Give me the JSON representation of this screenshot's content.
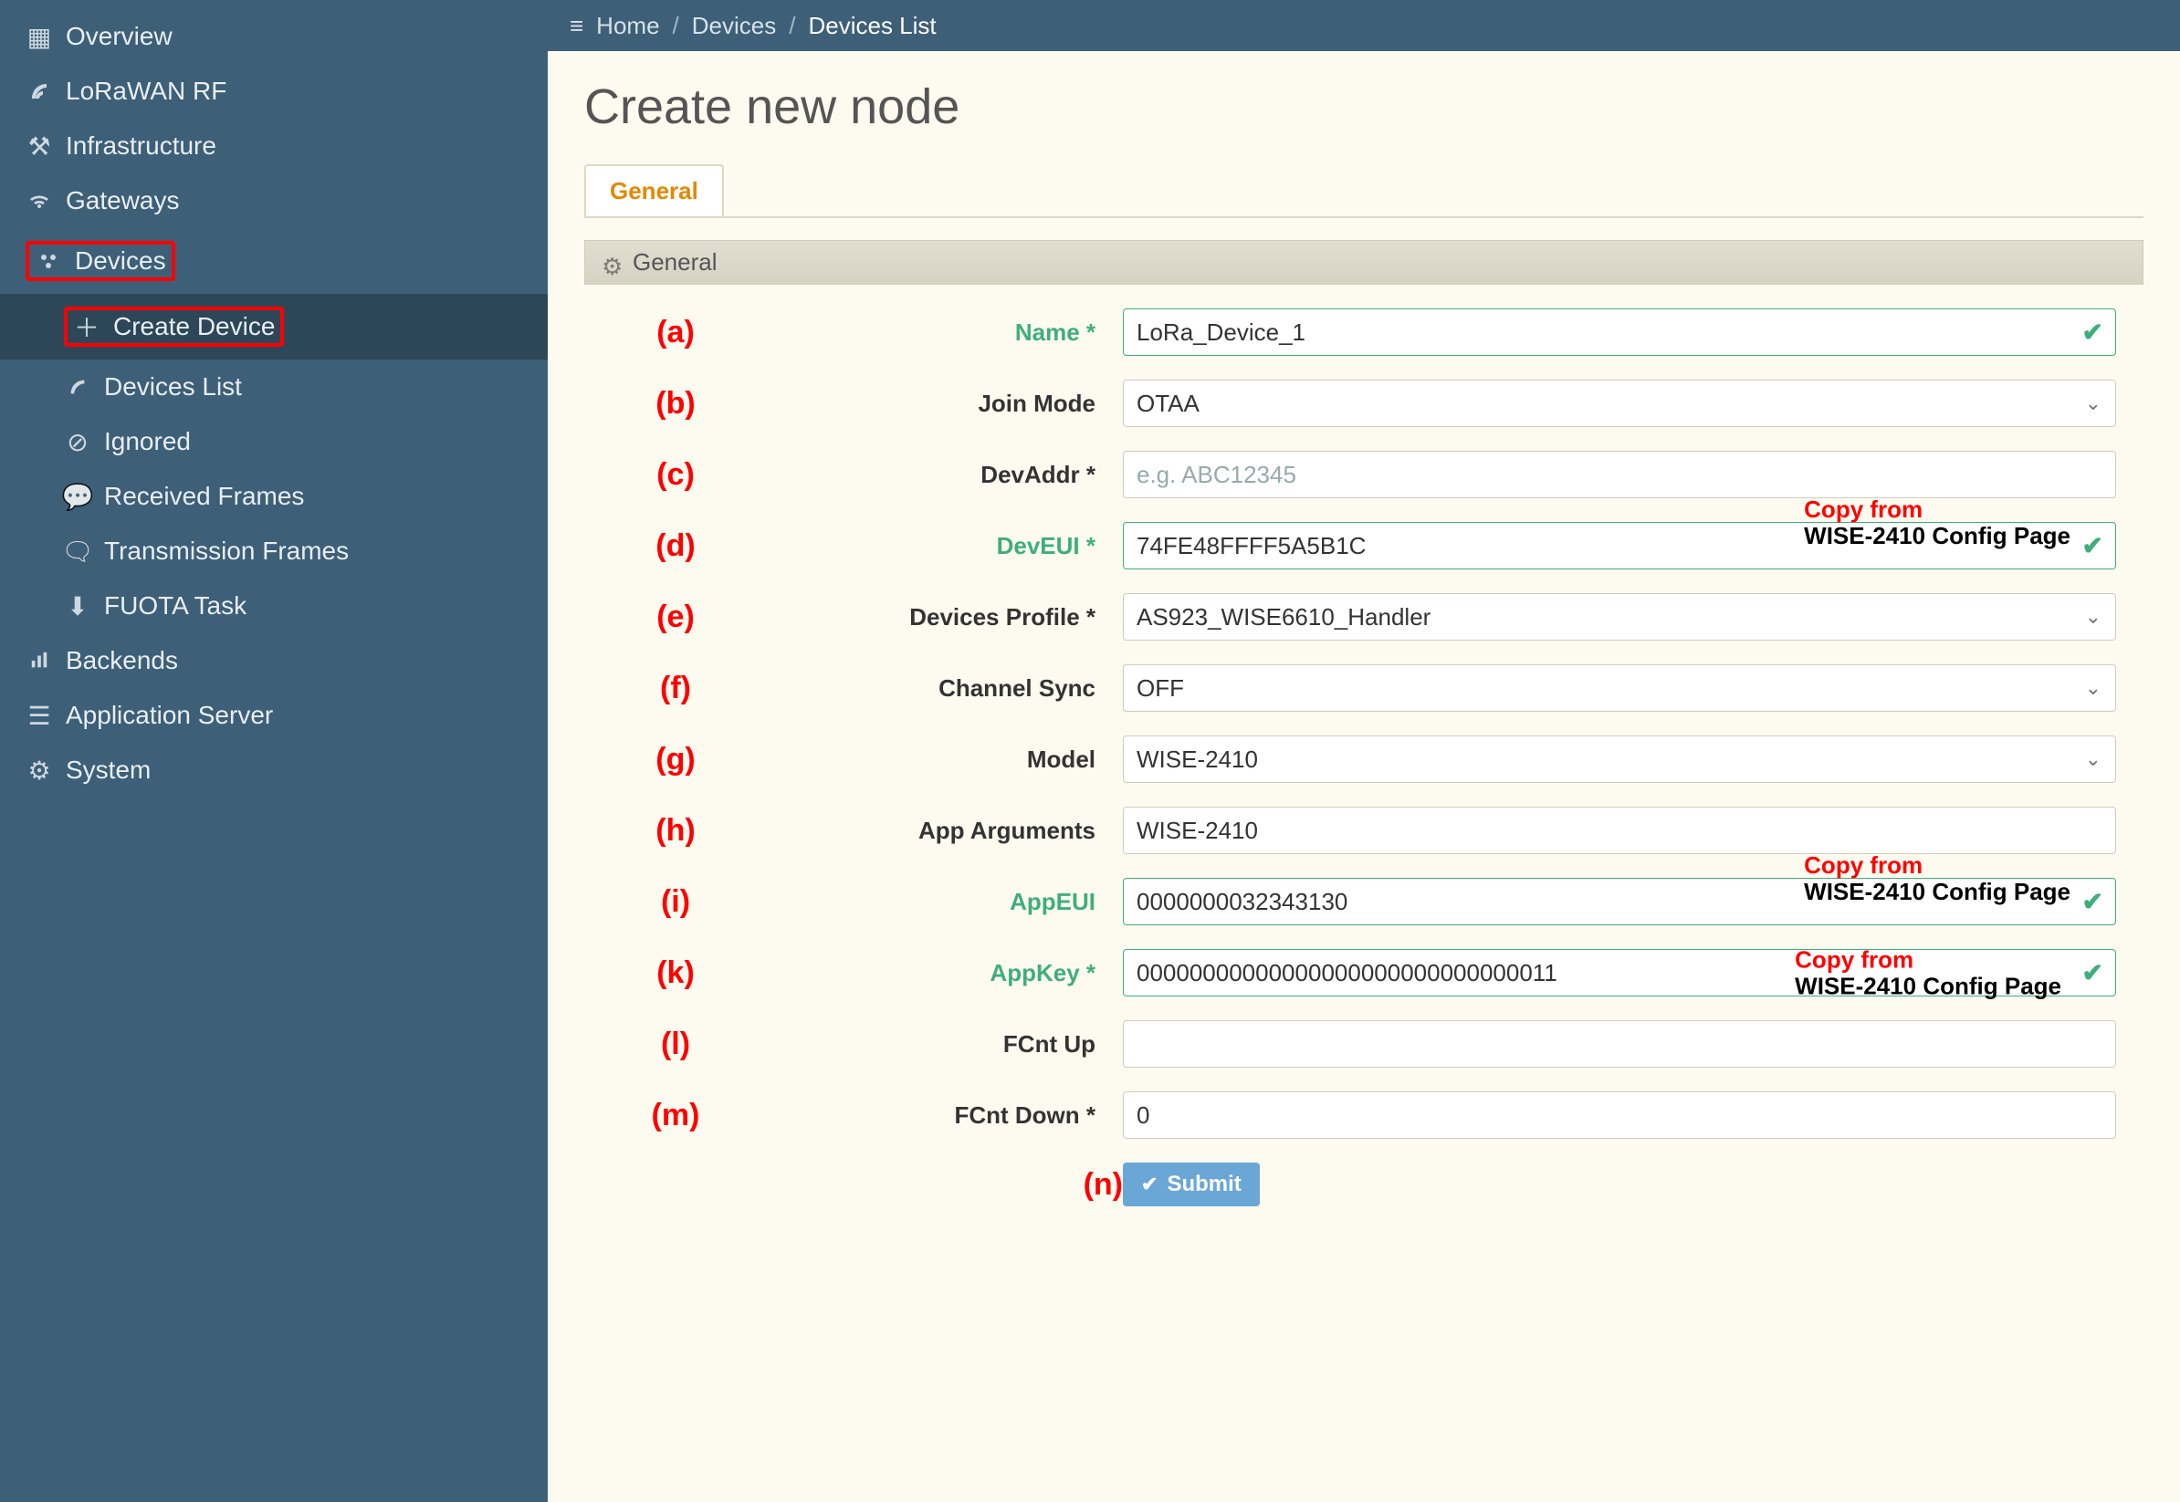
{
  "breadcrumbs": {
    "menu_icon": "≡",
    "home": "Home",
    "devices": "Devices",
    "devices_list": "Devices List"
  },
  "sidebar": {
    "overview": "Overview",
    "lorawan_rf": "LoRaWAN RF",
    "infra": "Infrastructure",
    "gateways": "Gateways",
    "devices": "Devices",
    "devices_children": {
      "create": "Create Device",
      "list": "Devices List",
      "ignored": "Ignored",
      "recvf": "Received Frames",
      "txf": "Transmission Frames",
      "fuota": "FUOTA Task"
    },
    "backends": "Backends",
    "appserver": "Application Server",
    "system": "System"
  },
  "page": {
    "title": "Create new node"
  },
  "tabs": {
    "general": "General"
  },
  "panel": {
    "general": "General"
  },
  "form": {
    "labels": {
      "name": "Name *",
      "join_mode": "Join Mode",
      "devaddr": "DevAddr *",
      "deveui": "DevEUI *",
      "profile": "Devices Profile *",
      "chsync": "Channel Sync",
      "model": "Model",
      "appargs": "App Arguments",
      "appeui": "AppEUI",
      "appkey": "AppKey *",
      "fcnt_up": "FCnt Up",
      "fcnt_down": "FCnt Down *"
    },
    "values": {
      "name": "LoRa_Device_1",
      "join_mode": "OTAA",
      "devaddr_placeholder": "e.g. ABC12345",
      "deveui": "74FE48FFFF5A5B1C",
      "profile": "AS923_WISE6610_Handler",
      "chsync": "OFF",
      "model": "WISE-2410",
      "appargs": "WISE-2410",
      "appeui": "0000000032343130",
      "appkey": "00000000000000000000000000000011",
      "fcnt_up": "",
      "fcnt_down": "0"
    },
    "annotations": {
      "a": "(a)",
      "b": "(b)",
      "c": "(c)",
      "d": "(d)",
      "e": "(e)",
      "f": "(f)",
      "g": "(g)",
      "h": "(h)",
      "i": "(i)",
      "k": "(k)",
      "l": "(l)",
      "m": "(m)",
      "n": "(n)"
    },
    "overlay": {
      "copy_from": "Copy from",
      "config_page": "WISE-2410 Config Page"
    },
    "submit": "Submit"
  }
}
